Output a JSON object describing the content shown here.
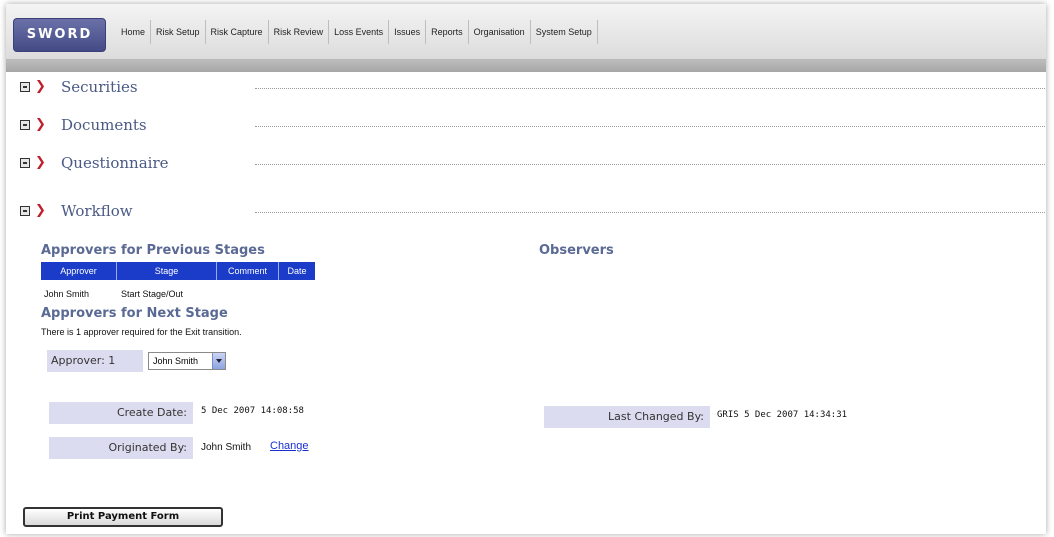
{
  "app": {
    "logo": "SWORD"
  },
  "nav": [
    "Home",
    "Risk Setup",
    "Risk Capture",
    "Risk Review",
    "Loss Events",
    "Issues",
    "Reports",
    "Organisation",
    "System Setup"
  ],
  "sections": {
    "securities": "Securities",
    "documents": "Documents",
    "questionnaire": "Questionnaire",
    "workflow": "Workflow"
  },
  "workflow": {
    "prev_title": "Approvers for Previous Stages",
    "observers_title": "Observers",
    "columns": [
      "Approver",
      "Stage",
      "Comment",
      "Date"
    ],
    "prev_row": {
      "approver": "John Smith",
      "stage": "Start Stage/Out"
    },
    "next_title": "Approvers for Next Stage",
    "next_note": "There is 1 approver required for the Exit transition.",
    "approver_label": "Approver: 1",
    "approver_value": "John Smith"
  },
  "details": {
    "create_date_label": "Create Date:",
    "create_date_value": "5 Dec 2007 14:08:58",
    "originated_label": "Originated By:",
    "originated_value": "John Smith",
    "change_link": "Change",
    "last_changed_label": "Last Changed By:",
    "last_changed_value": "GRIS  5 Dec 2007 14:34:31"
  },
  "buttons": {
    "print": "Print Payment Form"
  }
}
